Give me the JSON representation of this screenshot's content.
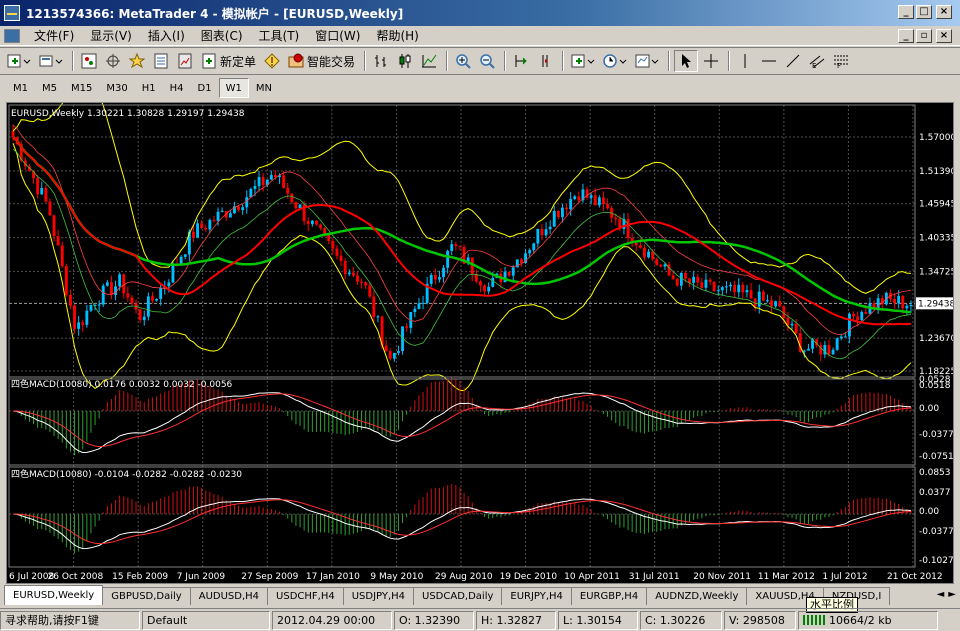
{
  "window": {
    "title": "1213574366: MetaTrader 4 - 模拟帐户 - [EURUSD,Weekly]",
    "buttons": [
      "_",
      "□",
      "×"
    ],
    "doc_buttons": [
      "_",
      "▫",
      "×"
    ]
  },
  "menu": [
    "文件(F)",
    "显示(V)",
    "插入(I)",
    "图表(C)",
    "工具(T)",
    "窗口(W)",
    "帮助(H)"
  ],
  "toolbar": {
    "new_order": "新定单",
    "expert_trading": "智能交易"
  },
  "timeframes": [
    "M1",
    "M5",
    "M15",
    "M30",
    "H1",
    "H4",
    "D1",
    "W1",
    "MN"
  ],
  "active_timeframe": "W1",
  "chart": {
    "header": "EURUSD,Weekly  1.30221 1.30828 1.29197 1.29438",
    "price_ticks": [
      "1.57000",
      "1.51390",
      "1.45945",
      "1.40335",
      "1.34725",
      "1.29438",
      "1.23670",
      "1.18225"
    ],
    "current_price": "1.29438",
    "macd1_header": "四色MACD(10080) 0.0176 0.0032 0.0032 -0.0056",
    "macd1_ticks": [
      "0.0528",
      "0.0518",
      "0.00",
      "-0.0377",
      "-0.0751"
    ],
    "macd2_header": "四色MACD(10080) -0.0104 -0.0282 -0.0282 -0.0230",
    "macd2_ticks": [
      "0.0853",
      "0.0377",
      "0.00",
      "-0.0377",
      "-0.1027"
    ],
    "date_ticks": [
      "6 Jul 2008",
      "26 Oct 2008",
      "15 Feb 2009",
      "7 Jun 2009",
      "27 Sep 2009",
      "17 Jan 2010",
      "9 May 2010",
      "29 Aug 2010",
      "19 Dec 2010",
      "10 Apr 2011",
      "31 Jul 2011",
      "20 Nov 2011",
      "11 Mar 2012",
      "1 Jul 2012",
      "21 Oct 2012"
    ],
    "colors": {
      "bull": "#00bfff",
      "bear": "#ff0000",
      "ma_slow": "#00c800",
      "ma_fast": "#ff0000",
      "bands": "#ffff00",
      "bg": "#000000"
    }
  },
  "tabs": [
    "EURUSD,Weekly",
    "GBPUSD,Daily",
    "AUDUSD,H4",
    "USDCHF,H4",
    "USDJPY,H4",
    "USDCAD,Daily",
    "EURJPY,H4",
    "EURGBP,H4",
    "AUDNZD,Weekly",
    "XAUUSD,H4",
    "NZDUSD,I"
  ],
  "tooltip": "水平比例",
  "status": {
    "help": "寻求帮助,请按F1键",
    "profile": "Default",
    "time": "2012.04.29 00:00",
    "open": "O: 1.32390",
    "high": "H: 1.32827",
    "low": "L: 1.30154",
    "close": "C: 1.30226",
    "volume": "V: 298508",
    "traffic": "10664/2 kb"
  }
}
